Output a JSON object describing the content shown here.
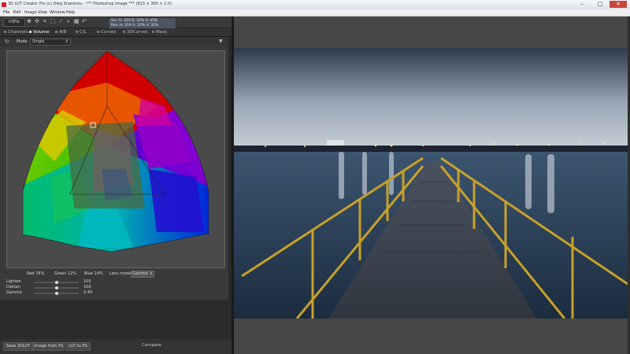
{
  "window": {
    "title": "3D LUT Creator Pro (c) Oleg Sharonov - *** Photoshop Image *** (813 × 360 × 1.0)",
    "minimize": "–",
    "maximize": "□",
    "close": "✕"
  },
  "menu": [
    "File",
    "Edit",
    "Image",
    "View",
    "Window",
    "Help"
  ],
  "toolbar": {
    "fps": "H3Fix",
    "tools": [
      "move-tool-icon",
      "pan-tool-icon",
      "crop-tool-icon",
      "select-tool-icon",
      "eyedropper-tool-icon",
      "zoom-tool-icon",
      "grid-tool-icon",
      "undo-tool-icon"
    ]
  },
  "readout": {
    "line1": "Src: H: 219  S: 32%  V: 45%",
    "line2": "Res: H: 219  S: 32%  V: 32%"
  },
  "tabs": [
    {
      "label": "Channels",
      "active": false
    },
    {
      "label": "Volume",
      "active": true
    },
    {
      "label": "A/B",
      "active": false
    },
    {
      "label": "C/L",
      "active": false
    },
    {
      "label": "Curves",
      "active": false
    },
    {
      "label": "3DCurves",
      "active": false
    },
    {
      "label": "Mask",
      "active": false
    }
  ],
  "mode": {
    "label": "Mode",
    "value": "Single"
  },
  "info": {
    "red": "Red  76%",
    "green": "Green  12%",
    "blue": "Blue  14%",
    "lensmode_label": "Lens mode",
    "lensmode_value": "Gamma"
  },
  "sliders": [
    {
      "label": "Lighten",
      "value": "100",
      "level": 0.5
    },
    {
      "label": "Darken",
      "value": "100",
      "level": 0.5
    },
    {
      "label": "Gamma",
      "value": "2.40",
      "level": 0.5
    }
  ],
  "buttons": {
    "save": "Save 3DLUT",
    "image_from_ps": "Image from PS",
    "lut_to_ps": "LUT to PS",
    "compare": "Compare"
  },
  "colors": {
    "panel": "#3a3a3a",
    "accent_tab": "#ffffff",
    "railing": "#c8a02a",
    "water": "#27415c"
  }
}
